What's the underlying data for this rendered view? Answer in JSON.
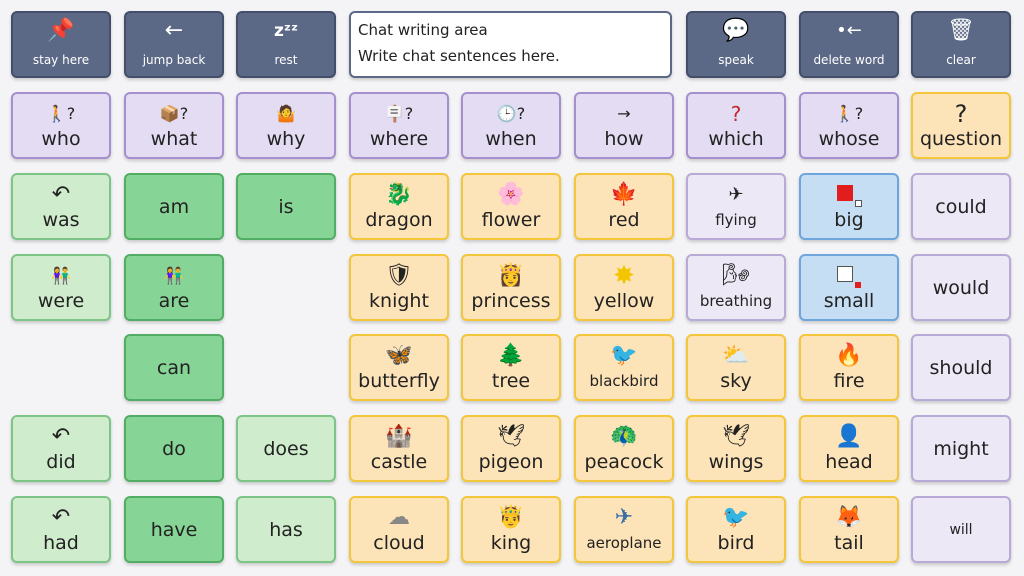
{
  "toolbar": {
    "stay_here": "stay here",
    "jump_back": "jump back",
    "rest": "rest",
    "speak": "speak",
    "delete_word": "delete word",
    "clear": "clear"
  },
  "chat": {
    "title": "Chat writing area",
    "placeholder": "Write chat sentences here."
  },
  "questions": {
    "who": "who",
    "what": "what",
    "why": "why",
    "where": "where",
    "when": "when",
    "how": "how",
    "which": "which",
    "whose": "whose",
    "question": "question"
  },
  "verbs": {
    "was": "was",
    "am": "am",
    "is": "is",
    "were": "were",
    "are": "are",
    "can": "can",
    "did": "did",
    "do": "do",
    "does": "does",
    "had": "had",
    "have": "have",
    "has": "has"
  },
  "nouns": {
    "dragon": "dragon",
    "flower": "flower",
    "red": "red",
    "flying": "flying",
    "big": "big",
    "could": "could",
    "knight": "knight",
    "princess": "princess",
    "yellow": "yellow",
    "breathing": "breathing",
    "small": "small",
    "would": "would",
    "butterfly": "butterfly",
    "tree": "tree",
    "blackbird": "blackbird",
    "sky": "sky",
    "fire": "fire",
    "should": "should",
    "castle": "castle",
    "pigeon": "pigeon",
    "peacock": "peacock",
    "wings": "wings",
    "head": "head",
    "might": "might",
    "cloud": "cloud",
    "king": "king",
    "aeroplane": "aeroplane",
    "bird": "bird",
    "tail": "tail",
    "will": "will"
  },
  "icons": {
    "stay_here": "📌",
    "jump_back": "←",
    "rest": "zᶻᶻ",
    "speak": "💬",
    "delete_word": "•←",
    "clear": "🗑",
    "who": "🚶?",
    "what": "📦?",
    "why": "🤷",
    "where": "🪧?",
    "when": "🕒?",
    "how": "→",
    "which": "?",
    "whose": "🚶?",
    "question": "?",
    "was": "↶",
    "were": "👫",
    "are": "👫",
    "did": "↶",
    "had": "↶",
    "dragon": "🐉",
    "flower": "🌸",
    "red": "🍁",
    "flying": "✈",
    "knight": "🛡",
    "princess": "👸",
    "yellow": "✸",
    "breathing": "🌬",
    "butterfly": "🦋",
    "tree": "🌲",
    "blackbird": "🐦",
    "sky": "⛅",
    "fire": "🔥",
    "castle": "🏰",
    "pigeon": "🕊",
    "peacock": "🦚",
    "wings": "🕊",
    "head": "👤",
    "cloud": "☁",
    "king": "🤴",
    "aeroplane": "✈",
    "bird": "🐦",
    "tail": "🦊"
  },
  "colors": {
    "toolbar": "#5b6886",
    "question_words": "#e3dcf2",
    "verbs_light": "#cfeccd",
    "verbs_dark": "#86d596",
    "nouns": "#fde3b8",
    "adjectives_size": "#c6def3",
    "modals": "#ece8f5"
  }
}
